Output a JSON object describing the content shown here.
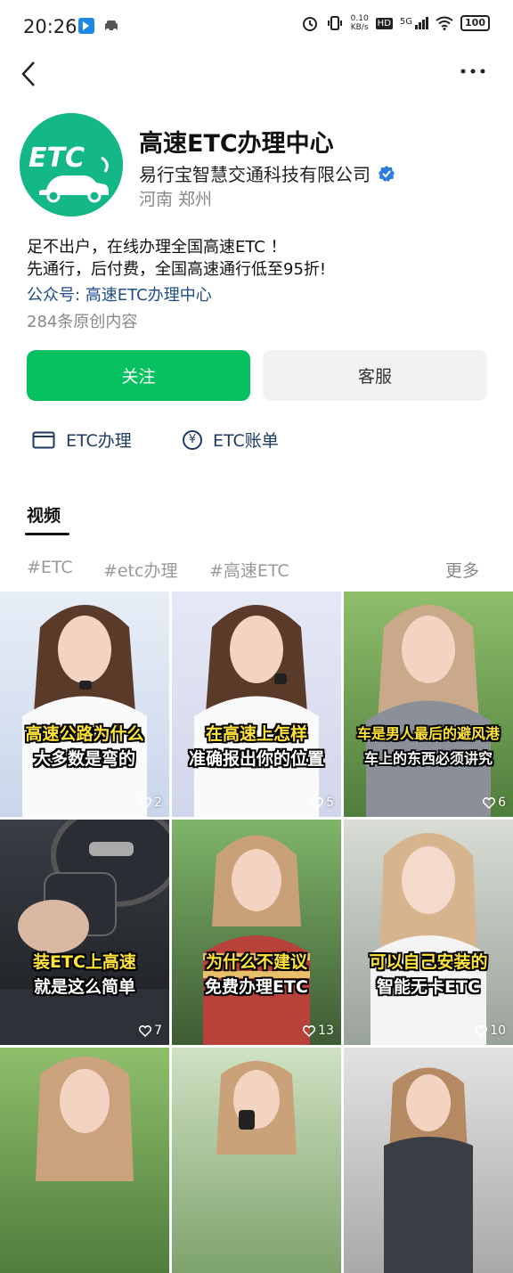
{
  "status": {
    "time": "20:26",
    "net_speed_top": "0.10",
    "net_speed_bottom": "KB/s",
    "hd": "HD",
    "signal": "5G",
    "battery": "100"
  },
  "profile": {
    "logo_text": "ETC",
    "name": "高速ETC办理中心",
    "company": "易行宝智慧交通科技有限公司",
    "location": "河南  郑州",
    "desc_line1": "足不出户，在线办理全国高速ETC ！",
    "desc_line2": "先通行，后付费，全国高速通行低至95折!",
    "oa_key": "公众号:",
    "oa_value": "高速ETC办理中心",
    "count": "284条原创内容"
  },
  "buttons": {
    "follow": "关注",
    "service": "客服"
  },
  "menu": {
    "item1": "ETC办理",
    "item2": "ETC账单",
    "yen": "¥"
  },
  "tabs": {
    "active": "视频"
  },
  "tags": {
    "t1": "#ETC",
    "t2": "#etc办理",
    "t3": "#高速ETC",
    "more": "更多"
  },
  "videos": [
    {
      "cap1": "高速公路为什么",
      "cap2": "大多数是弯的",
      "likes": "2"
    },
    {
      "cap1": "在高速上怎样",
      "cap2": "准确报出你的位置",
      "likes": "5"
    },
    {
      "cap1": "车是男人最后的避风港",
      "cap2": "车上的东西必须讲究",
      "likes": "6"
    },
    {
      "cap1": "装ETC上高速",
      "cap2": "就是这么简单",
      "likes": "7"
    },
    {
      "cap1": "为什么不建议",
      "cap2": "免费办理ETC",
      "likes": "13"
    },
    {
      "cap1": "可以自己安装的",
      "cap2": "智能无卡ETC",
      "likes": "10"
    }
  ],
  "colors": {
    "brand_green": "#07c160",
    "logo_green": "#12b886",
    "link_blue": "#1d4e89"
  }
}
